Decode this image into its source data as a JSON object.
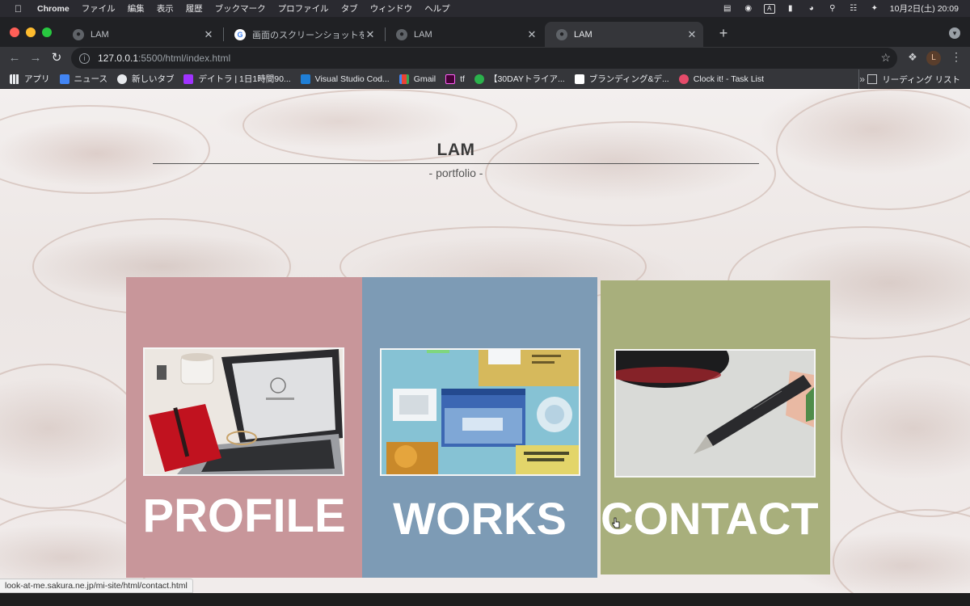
{
  "menubar": {
    "app_name": "Chrome",
    "items": [
      "ファイル",
      "編集",
      "表示",
      "履歴",
      "ブックマーク",
      "プロファイル",
      "タブ",
      "ウィンドウ",
      "ヘルプ"
    ],
    "input_badge": "A",
    "clock": "10月2日(土)  20:09"
  },
  "tabs": [
    {
      "label": "LAM",
      "icon": "globe-icon"
    },
    {
      "label": "画面のスクリーンショットを撮影する",
      "icon": "google-icon"
    },
    {
      "label": "LAM",
      "icon": "globe-icon"
    },
    {
      "label": "LAM",
      "icon": "globe-icon",
      "active": true
    }
  ],
  "toolbar": {
    "url_host": "127.0.0.1",
    "url_rest": ":5500/html/index.html",
    "profile_initial": "L"
  },
  "bookmarks": {
    "items": [
      {
        "label": "アプリ",
        "color": "#e8eaed"
      },
      {
        "label": "ニュース",
        "color": "#4285f4"
      },
      {
        "label": "新しいタブ",
        "color": "#e8eaed"
      },
      {
        "label": "デイトラ | 1日1時間90...",
        "color": "#a033ff"
      },
      {
        "label": "Visual Studio Cod...",
        "color": "#1f7fd6"
      },
      {
        "label": "Gmail",
        "color": "#ea4335"
      },
      {
        "label": "tf",
        "color": "#ff3366"
      },
      {
        "label": "【30DAYトライア...",
        "color": "#2bb24c"
      },
      {
        "label": "ブランディング&デ...",
        "color": "#ffffff"
      },
      {
        "label": "Clock it! - Task List",
        "color": "#e54b6a"
      }
    ],
    "more": "»",
    "reading_list": "リーディング リスト"
  },
  "page": {
    "title": "LAM",
    "subtitle": "- portfolio -",
    "cards": {
      "profile": "PROFILE",
      "works": "WORKS",
      "contact": "CONTACT"
    },
    "colors": {
      "profile": "#c8969a",
      "works": "#7d9bb5",
      "contact": "#a8af7c"
    }
  },
  "status_bar": {
    "link_url": "look-at-me.sakura.ne.jp/mi-site/html/contact.html"
  }
}
